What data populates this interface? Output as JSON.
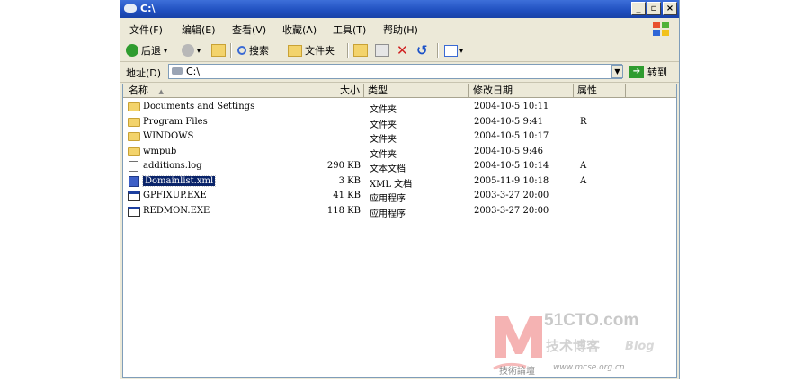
{
  "window": {
    "title": "C:\\"
  },
  "menu": [
    "文件(F)",
    "编辑(E)",
    "查看(V)",
    "收藏(A)",
    "工具(T)",
    "帮助(H)"
  ],
  "toolbar": {
    "back": "后退",
    "search": "搜索",
    "folders": "文件夹"
  },
  "address": {
    "label": "地址(D)",
    "value": "C:\\",
    "go": "转到"
  },
  "columns": [
    "名称",
    "大小",
    "类型",
    "修改日期",
    "属性"
  ],
  "files": [
    {
      "name": "Documents and Settings",
      "size": "",
      "type": "文件夹",
      "date": "2004-10-5 10:11",
      "attr": "",
      "icon": "folder"
    },
    {
      "name": "Program Files",
      "size": "",
      "type": "文件夹",
      "date": "2004-10-5 9:41",
      "attr": "R",
      "icon": "folder"
    },
    {
      "name": "WINDOWS",
      "size": "",
      "type": "文件夹",
      "date": "2004-10-5 10:17",
      "attr": "",
      "icon": "folder"
    },
    {
      "name": "wmpub",
      "size": "",
      "type": "文件夹",
      "date": "2004-10-5 9:46",
      "attr": "",
      "icon": "folder"
    },
    {
      "name": "additions.log",
      "size": "290 KB",
      "type": "文本文档",
      "date": "2004-10-5 10:14",
      "attr": "A",
      "icon": "doc"
    },
    {
      "name": "Domainlist.xml",
      "size": "3 KB",
      "type": "XML 文档",
      "date": "2005-11-9 10:18",
      "attr": "A",
      "icon": "xml",
      "selected": true
    },
    {
      "name": "GPFIXUP.EXE",
      "size": "41 KB",
      "type": "应用程序",
      "date": "2003-3-27 20:00",
      "attr": "",
      "icon": "exe"
    },
    {
      "name": "REDMON.EXE",
      "size": "118 KB",
      "type": "应用程序",
      "date": "2003-3-27 20:00",
      "attr": "",
      "icon": "exe"
    }
  ],
  "watermark": {
    "logo": "51CTO.com",
    "tagline": "技术博客",
    "blog": "Blog",
    "sub": "技術論壇",
    "url": "www.mcse.org.cn"
  },
  "colors": {
    "titlebar": "#2450c0",
    "selection": "#0a246a",
    "chrome": "#ece9d8"
  }
}
